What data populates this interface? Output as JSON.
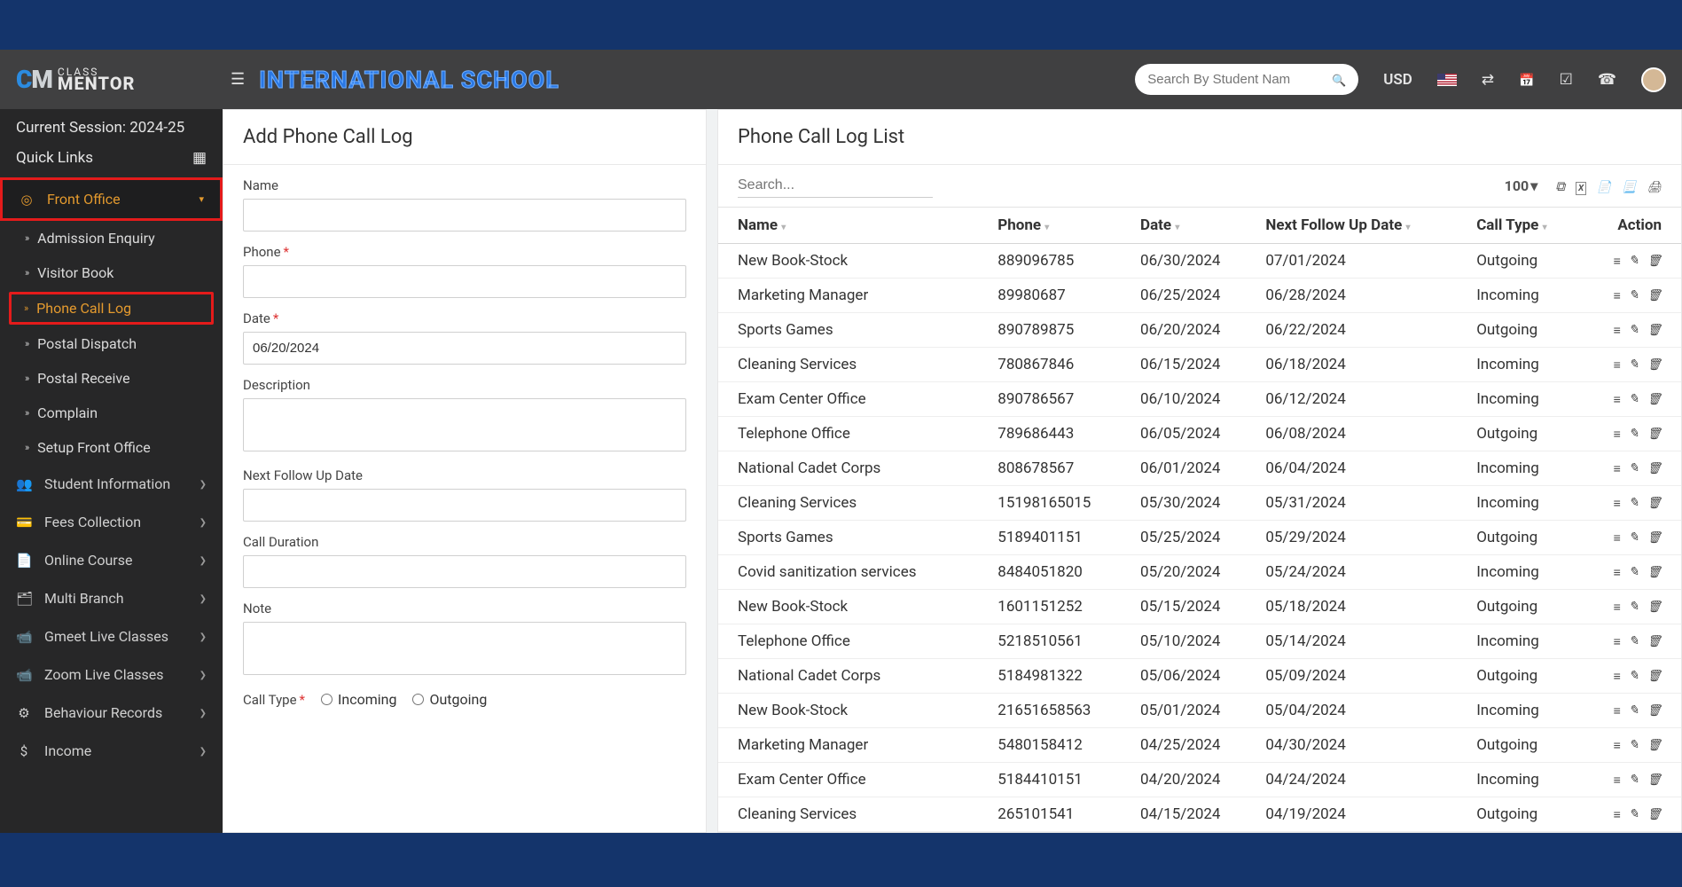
{
  "header": {
    "logo_small": "CLASS",
    "logo_big": "MENTOR",
    "school_name": "INTERNATIONAL SCHOOL",
    "search_placeholder": "Search By Student Nam",
    "currency": "USD"
  },
  "sidebar": {
    "session_label": "Current Session: 2024-25",
    "quick_links_label": "Quick Links",
    "front_office": {
      "label": "Front Office",
      "items": [
        "Admission Enquiry",
        "Visitor Book",
        "Phone Call Log",
        "Postal Dispatch",
        "Postal Receive",
        "Complain",
        "Setup Front Office"
      ]
    },
    "nav": [
      {
        "icon": "👥",
        "label": "Student Information"
      },
      {
        "icon": "💳",
        "label": "Fees Collection"
      },
      {
        "icon": "📄",
        "label": "Online Course"
      },
      {
        "icon": "🗂",
        "label": "Multi Branch"
      },
      {
        "icon": "📹",
        "label": "Gmeet Live Classes"
      },
      {
        "icon": "📹",
        "label": "Zoom Live Classes"
      },
      {
        "icon": "⚙",
        "label": "Behaviour Records"
      },
      {
        "icon": "$",
        "label": "Income"
      }
    ]
  },
  "form": {
    "title": "Add Phone Call Log",
    "name_label": "Name",
    "phone_label": "Phone",
    "date_label": "Date",
    "date_value": "06/20/2024",
    "desc_label": "Description",
    "followup_label": "Next Follow Up Date",
    "duration_label": "Call Duration",
    "note_label": "Note",
    "calltype_label": "Call Type",
    "incoming_label": "Incoming",
    "outgoing_label": "Outgoing"
  },
  "list": {
    "title": "Phone Call Log List",
    "search_placeholder": "Search...",
    "page_size": "100",
    "columns": {
      "name": "Name",
      "phone": "Phone",
      "date": "Date",
      "followup": "Next Follow Up Date",
      "calltype": "Call Type",
      "action": "Action"
    },
    "rows": [
      {
        "name": "New Book-Stock",
        "phone": "889096785",
        "date": "06/30/2024",
        "followup": "07/01/2024",
        "type": "Outgoing"
      },
      {
        "name": "Marketing Manager",
        "phone": "89980687",
        "date": "06/25/2024",
        "followup": "06/28/2024",
        "type": "Incoming"
      },
      {
        "name": "Sports Games",
        "phone": "890789875",
        "date": "06/20/2024",
        "followup": "06/22/2024",
        "type": "Outgoing"
      },
      {
        "name": "Cleaning Services",
        "phone": "780867846",
        "date": "06/15/2024",
        "followup": "06/18/2024",
        "type": "Incoming"
      },
      {
        "name": "Exam Center Office",
        "phone": "890786567",
        "date": "06/10/2024",
        "followup": "06/12/2024",
        "type": "Incoming"
      },
      {
        "name": "Telephone Office",
        "phone": "789686443",
        "date": "06/05/2024",
        "followup": "06/08/2024",
        "type": "Outgoing"
      },
      {
        "name": "National Cadet Corps",
        "phone": "808678567",
        "date": "06/01/2024",
        "followup": "06/04/2024",
        "type": "Incoming"
      },
      {
        "name": "Cleaning Services",
        "phone": "15198165015",
        "date": "05/30/2024",
        "followup": "05/31/2024",
        "type": "Incoming"
      },
      {
        "name": "Sports Games",
        "phone": "5189401151",
        "date": "05/25/2024",
        "followup": "05/29/2024",
        "type": "Outgoing"
      },
      {
        "name": "Covid sanitization services",
        "phone": "8484051820",
        "date": "05/20/2024",
        "followup": "05/24/2024",
        "type": "Incoming"
      },
      {
        "name": "New Book-Stock",
        "phone": "1601151252",
        "date": "05/15/2024",
        "followup": "05/18/2024",
        "type": "Outgoing"
      },
      {
        "name": "Telephone Office",
        "phone": "5218510561",
        "date": "05/10/2024",
        "followup": "05/14/2024",
        "type": "Incoming"
      },
      {
        "name": "National Cadet Corps",
        "phone": "5184981322",
        "date": "05/06/2024",
        "followup": "05/09/2024",
        "type": "Outgoing"
      },
      {
        "name": "New Book-Stock",
        "phone": "21651658563",
        "date": "05/01/2024",
        "followup": "05/04/2024",
        "type": "Incoming"
      },
      {
        "name": "Marketing Manager",
        "phone": "5480158412",
        "date": "04/25/2024",
        "followup": "04/30/2024",
        "type": "Outgoing"
      },
      {
        "name": "Exam Center Office",
        "phone": "5184410151",
        "date": "04/20/2024",
        "followup": "04/24/2024",
        "type": "Incoming"
      },
      {
        "name": "Cleaning Services",
        "phone": "265101541",
        "date": "04/15/2024",
        "followup": "04/19/2024",
        "type": "Outgoing"
      }
    ]
  }
}
